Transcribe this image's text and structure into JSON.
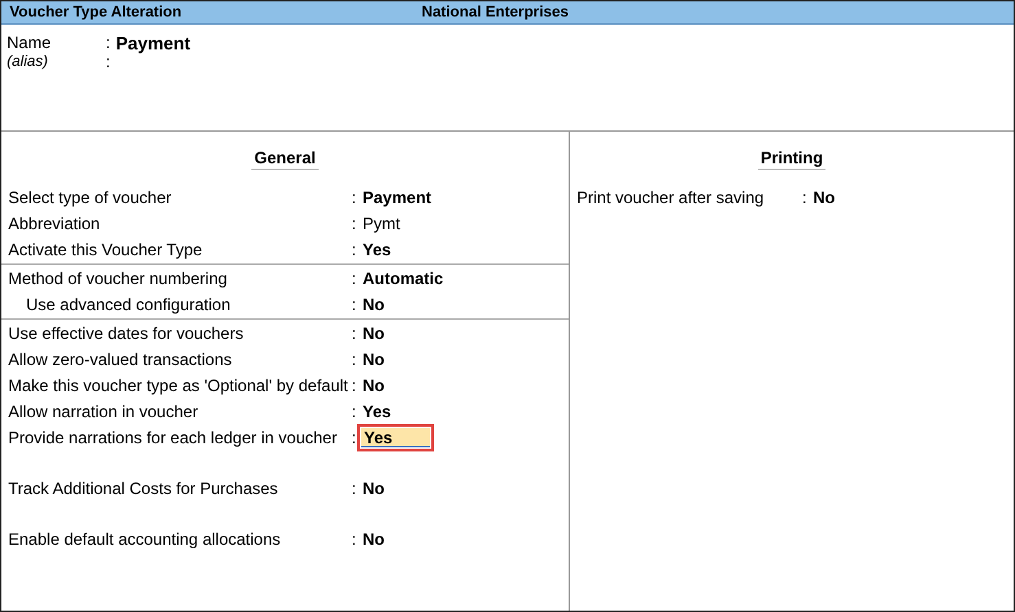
{
  "window": {
    "title": "Voucher Type Alteration",
    "company": "National Enterprises"
  },
  "name_block": {
    "rows": [
      {
        "label": "Name",
        "colon": ":",
        "value": "Payment",
        "italic": false
      },
      {
        "label": "(alias)",
        "colon": ":",
        "value": "",
        "italic": true
      }
    ]
  },
  "general": {
    "heading": "General",
    "groups": [
      {
        "kind": "first",
        "rows": [
          {
            "label": "Select type of voucher",
            "colon": ":",
            "value": "Payment",
            "kind": "option",
            "indented": false,
            "focused": false
          },
          {
            "label": "Abbreviation",
            "colon": ":",
            "value": "Pymt",
            "kind": "text",
            "indented": false,
            "focused": false
          },
          {
            "label": "Activate this Voucher Type",
            "colon": ":",
            "value": "Yes",
            "kind": "option",
            "indented": false,
            "focused": false
          }
        ]
      },
      {
        "kind": "ruled",
        "rows": [
          {
            "label": "Method of voucher numbering",
            "colon": ":",
            "value": "Automatic",
            "kind": "option",
            "indented": false,
            "focused": false
          },
          {
            "label": "Use advanced configuration",
            "colon": ":",
            "value": "No",
            "kind": "option",
            "indented": true,
            "focused": false
          }
        ]
      },
      {
        "kind": "ruled",
        "rows": [
          {
            "label": "Use effective dates for vouchers",
            "colon": ":",
            "value": "No",
            "kind": "option",
            "indented": false,
            "focused": false
          },
          {
            "label": "Allow zero-valued transactions",
            "colon": ":",
            "value": "No",
            "kind": "option",
            "indented": false,
            "focused": false
          },
          {
            "label": "Make this voucher type as 'Optional' by default",
            "colon": ":",
            "value": "No",
            "kind": "option",
            "indented": false,
            "focused": false
          },
          {
            "label": "Allow narration in voucher",
            "colon": ":",
            "value": "Yes",
            "kind": "option",
            "indented": false,
            "focused": false
          },
          {
            "label": "Provide narrations for each ledger in voucher",
            "colon": ":",
            "value": "Yes",
            "kind": "option",
            "indented": false,
            "focused": true
          }
        ]
      },
      {
        "kind": "spaced",
        "rows": [
          {
            "label": "Track Additional Costs for Purchases",
            "colon": ":",
            "value": "No",
            "kind": "option",
            "indented": false,
            "focused": false
          }
        ]
      },
      {
        "kind": "spaced",
        "rows": [
          {
            "label": "Enable default accounting allocations",
            "colon": ":",
            "value": "No",
            "kind": "option",
            "indented": false,
            "focused": false
          }
        ]
      }
    ]
  },
  "printing": {
    "heading": "Printing",
    "rows": [
      {
        "label": "Print voucher after saving",
        "colon": ":",
        "value": "No",
        "kind": "option",
        "indented": false,
        "focused": false
      }
    ]
  }
}
